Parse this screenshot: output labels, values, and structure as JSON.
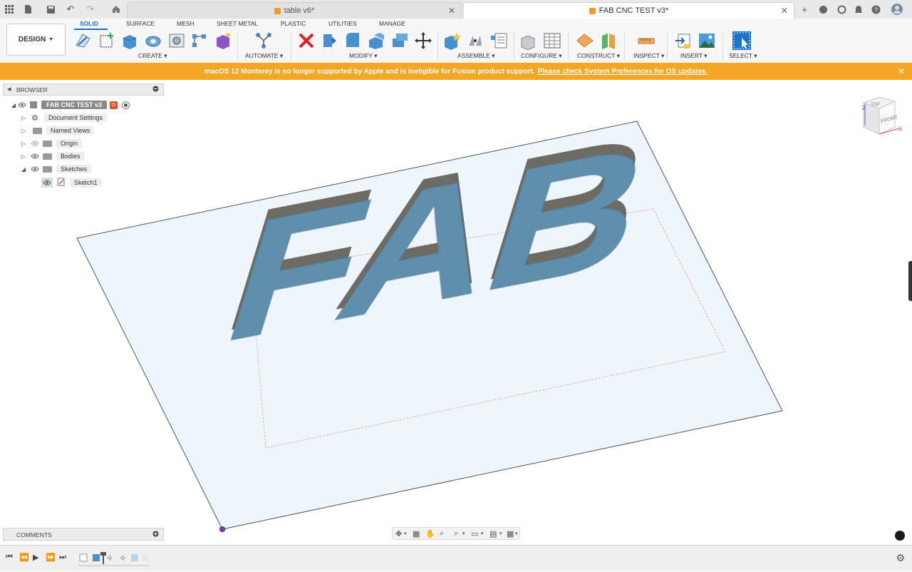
{
  "tabs": [
    {
      "label": "table v6*",
      "active": false
    },
    {
      "label": "FAB CNC TEST v3*",
      "active": true
    }
  ],
  "workspace": {
    "design_label": "DESIGN",
    "tabs": [
      "SOLID",
      "SURFACE",
      "MESH",
      "SHEET METAL",
      "PLASTIC",
      "UTILITIES",
      "MANAGE"
    ],
    "active_tab": "SOLID"
  },
  "tool_groups": {
    "create": "CREATE",
    "automate": "AUTOMATE",
    "modify": "MODIFY",
    "assemble": "ASSEMBLE",
    "configure": "CONFIGURE",
    "construct": "CONSTRUCT",
    "inspect": "INSPECT",
    "insert": "INSERT",
    "select": "SELECT"
  },
  "notice": {
    "text": "macOS 12 Monterey is no longer supported by Apple and is ineligible for Fusion product support.",
    "link": "Please check System Preferences for OS updates."
  },
  "browser": {
    "title": "BROWSER",
    "root": "FAB CNC TEST v3",
    "items": [
      "Document Settings",
      "Named Views",
      "Origin",
      "Bodies",
      "Sketches"
    ],
    "sketch": "Sketch1"
  },
  "comments": {
    "title": "COMMENTS"
  },
  "viewcube": {
    "top": "TOP",
    "front": "FRONT",
    "x": "X",
    "z": "Z"
  },
  "model_text": "FAB",
  "colors": {
    "accent": "#1a6fbf",
    "notice": "#f5a623",
    "body_fill": "#5f8fac",
    "plane_fill": "#eef6fc"
  }
}
